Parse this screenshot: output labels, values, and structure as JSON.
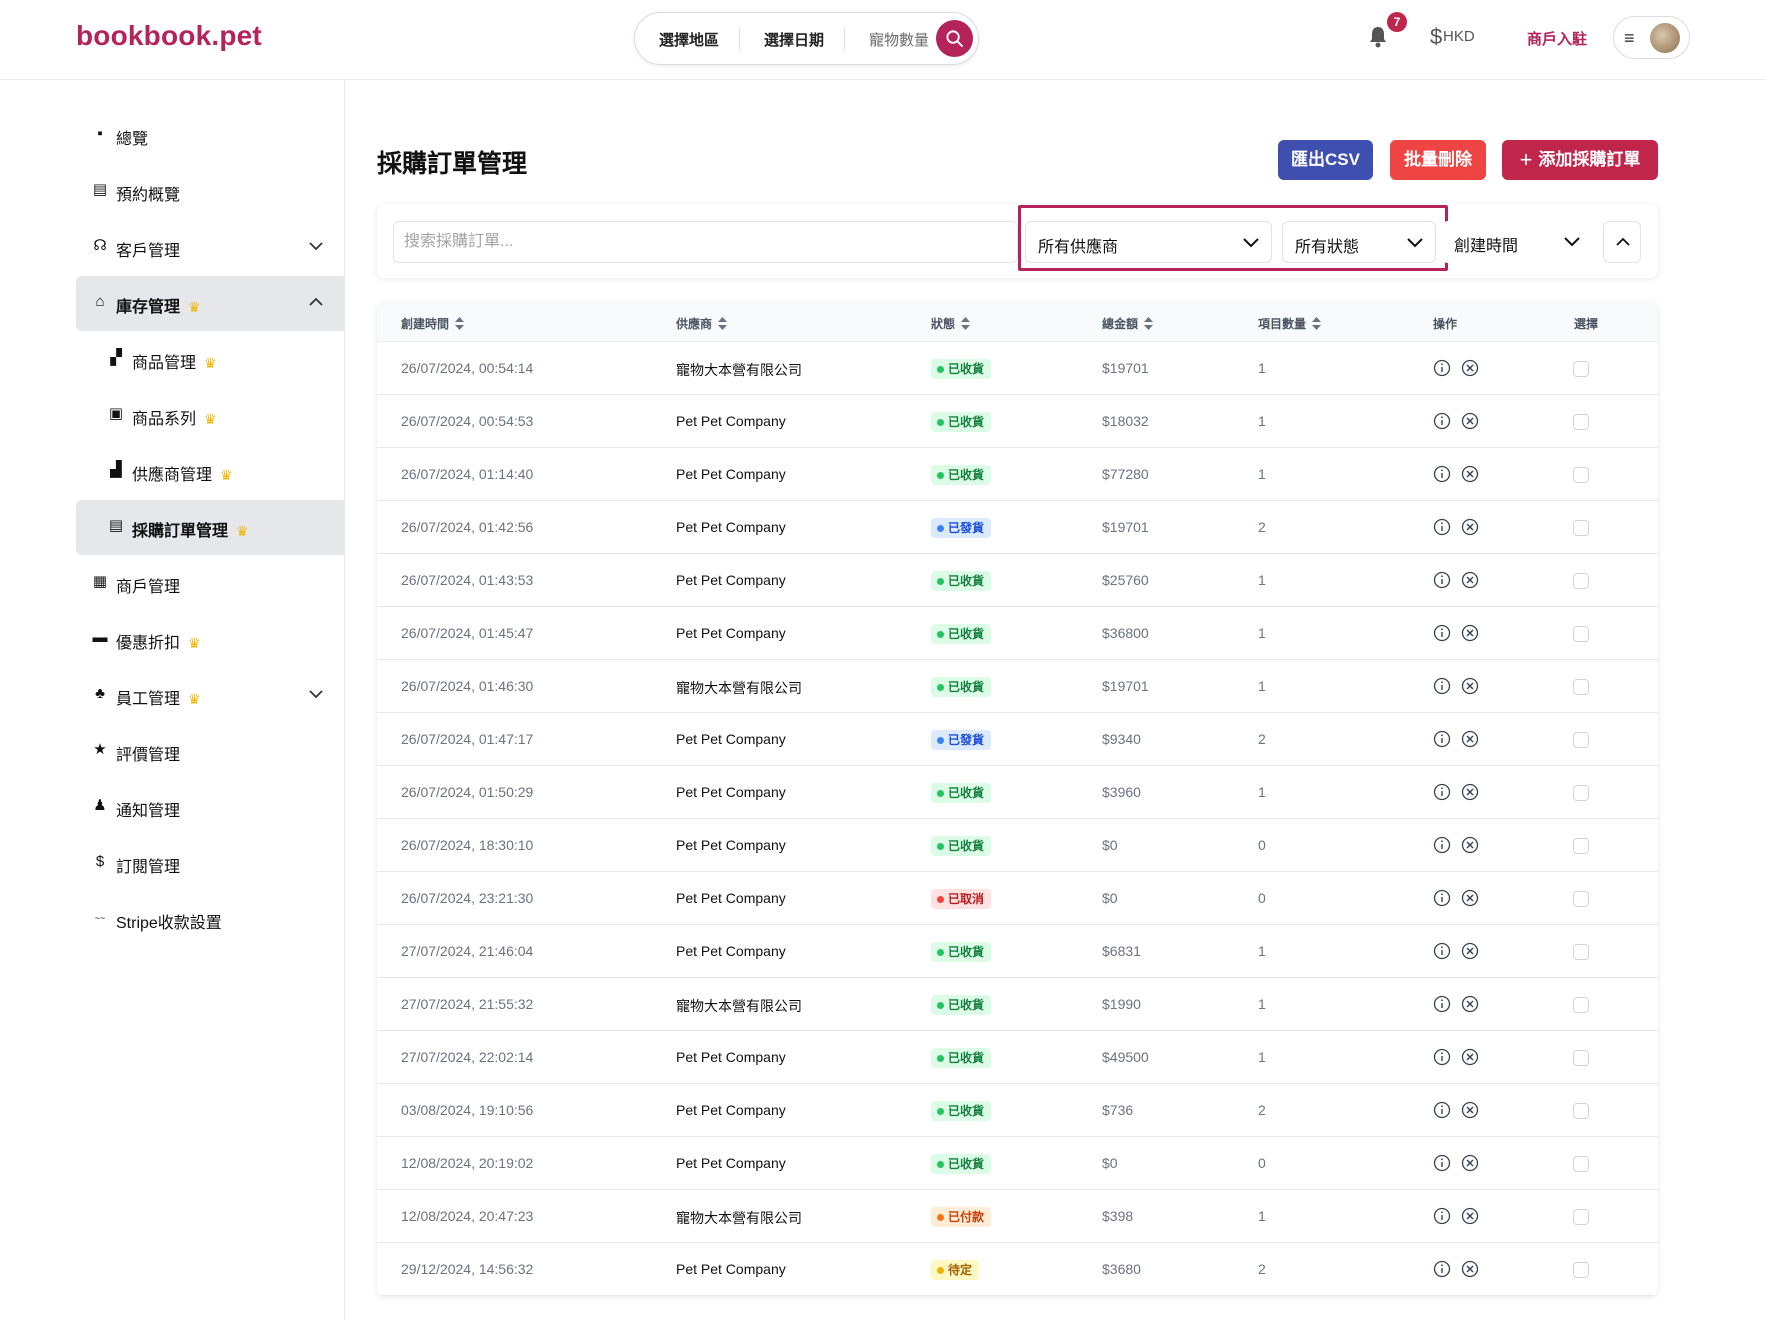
{
  "header": {
    "logo": "bookbook.pet",
    "search": {
      "region": "選擇地區",
      "date": "選擇日期",
      "pets": "寵物數量"
    },
    "notification_count": "7",
    "currency": "HKD",
    "merchant_link": "商戶入駐"
  },
  "sidebar": {
    "items": [
      {
        "label": "總覽",
        "icon": "dashboard-icon"
      },
      {
        "label": "預約概覽",
        "icon": "calendar-icon"
      },
      {
        "label": "客戶管理",
        "icon": "headset-icon"
      },
      {
        "label": "庫存管理",
        "icon": "warehouse-icon"
      },
      {
        "label": "商品管理",
        "icon": "boxes-icon"
      },
      {
        "label": "商品系列",
        "icon": "archive-icon"
      },
      {
        "label": "供應商管理",
        "icon": "factory-icon"
      },
      {
        "label": "採購訂單管理",
        "icon": "calendar-icon"
      },
      {
        "label": "商戶管理",
        "icon": "store-icon"
      },
      {
        "label": "優惠折扣",
        "icon": "ticket-icon"
      },
      {
        "label": "員工管理",
        "icon": "org-chart-icon"
      },
      {
        "label": "評價管理",
        "icon": "star-icon"
      },
      {
        "label": "通知管理",
        "icon": "bell-icon"
      },
      {
        "label": "訂閱管理",
        "icon": "dollar-icon"
      },
      {
        "label": "Stripe收款設置",
        "icon": "stripe-icon"
      }
    ]
  },
  "main": {
    "title": "採購訂單管理",
    "buttons": {
      "export_csv": "匯出CSV",
      "batch_delete": "批量刪除",
      "add_order": "添加採購訂單"
    },
    "filters": {
      "search_placeholder": "搜索採購訂單...",
      "supplier": "所有供應商",
      "status": "所有狀態",
      "sort": "創建時間"
    },
    "table": {
      "headers": {
        "time": "創建時間",
        "supplier": "供應商",
        "status": "狀態",
        "amount": "總金額",
        "count": "項目數量",
        "actions": "操作",
        "select": "選擇"
      },
      "rows": [
        {
          "time": "26/07/2024, 00:54:14",
          "supplier": "寵物大本營有限公司",
          "status": "已收貨",
          "tone": "green",
          "amount": "$19701",
          "count": "1"
        },
        {
          "time": "26/07/2024, 00:54:53",
          "supplier": "Pet Pet Company",
          "status": "已收貨",
          "tone": "green",
          "amount": "$18032",
          "count": "1"
        },
        {
          "time": "26/07/2024, 01:14:40",
          "supplier": "Pet Pet Company",
          "status": "已收貨",
          "tone": "green",
          "amount": "$77280",
          "count": "1"
        },
        {
          "time": "26/07/2024, 01:42:56",
          "supplier": "Pet Pet Company",
          "status": "已發貨",
          "tone": "blue",
          "amount": "$19701",
          "count": "2"
        },
        {
          "time": "26/07/2024, 01:43:53",
          "supplier": "Pet Pet Company",
          "status": "已收貨",
          "tone": "green",
          "amount": "$25760",
          "count": "1"
        },
        {
          "time": "26/07/2024, 01:45:47",
          "supplier": "Pet Pet Company",
          "status": "已收貨",
          "tone": "green",
          "amount": "$36800",
          "count": "1"
        },
        {
          "time": "26/07/2024, 01:46:30",
          "supplier": "寵物大本營有限公司",
          "status": "已收貨",
          "tone": "green",
          "amount": "$19701",
          "count": "1"
        },
        {
          "time": "26/07/2024, 01:47:17",
          "supplier": "Pet Pet Company",
          "status": "已發貨",
          "tone": "blue",
          "amount": "$9340",
          "count": "2"
        },
        {
          "time": "26/07/2024, 01:50:29",
          "supplier": "Pet Pet Company",
          "status": "已收貨",
          "tone": "green",
          "amount": "$3960",
          "count": "1"
        },
        {
          "time": "26/07/2024, 18:30:10",
          "supplier": "Pet Pet Company",
          "status": "已收貨",
          "tone": "green",
          "amount": "$0",
          "count": "0"
        },
        {
          "time": "26/07/2024, 23:21:30",
          "supplier": "Pet Pet Company",
          "status": "已取消",
          "tone": "red",
          "amount": "$0",
          "count": "0"
        },
        {
          "time": "27/07/2024, 21:46:04",
          "supplier": "Pet Pet Company",
          "status": "已收貨",
          "tone": "green",
          "amount": "$6831",
          "count": "1"
        },
        {
          "time": "27/07/2024, 21:55:32",
          "supplier": "寵物大本營有限公司",
          "status": "已收貨",
          "tone": "green",
          "amount": "$1990",
          "count": "1"
        },
        {
          "time": "27/07/2024, 22:02:14",
          "supplier": "Pet Pet Company",
          "status": "已收貨",
          "tone": "green",
          "amount": "$49500",
          "count": "1"
        },
        {
          "time": "03/08/2024, 19:10:56",
          "supplier": "Pet Pet Company",
          "status": "已收貨",
          "tone": "green",
          "amount": "$736",
          "count": "2"
        },
        {
          "time": "12/08/2024, 20:19:02",
          "supplier": "Pet Pet Company",
          "status": "已收貨",
          "tone": "green",
          "amount": "$0",
          "count": "0"
        },
        {
          "time": "12/08/2024, 20:47:23",
          "supplier": "寵物大本營有限公司",
          "status": "已付款",
          "tone": "orange",
          "amount": "$398",
          "count": "1"
        },
        {
          "time": "29/12/2024, 14:56:32",
          "supplier": "Pet Pet Company",
          "status": "待定",
          "tone": "yellow",
          "amount": "$3680",
          "count": "2"
        }
      ]
    }
  }
}
